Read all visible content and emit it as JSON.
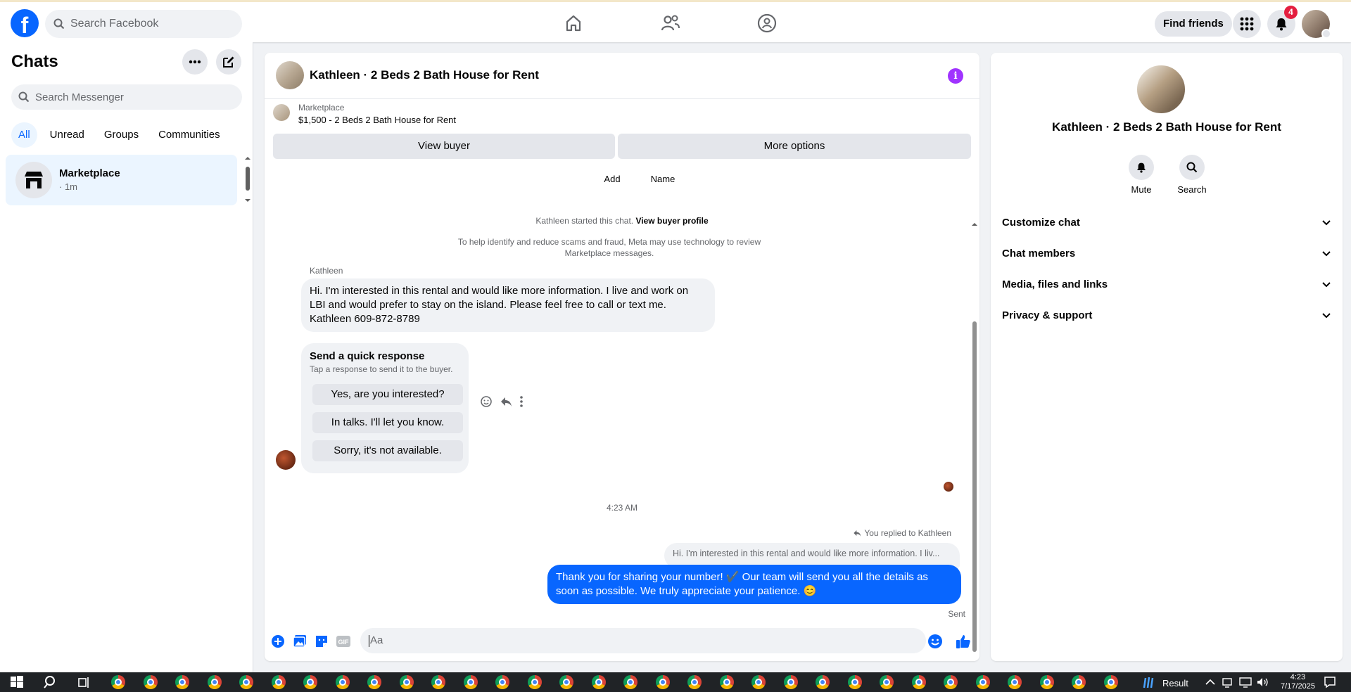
{
  "topbar": {
    "logo_letter": "f",
    "search_placeholder": "Search Facebook",
    "find_friends": "Find friends",
    "notification_count": "4"
  },
  "sidebar": {
    "title": "Chats",
    "search_placeholder": "Search Messenger",
    "filters": [
      "All",
      "Unread",
      "Groups",
      "Communities"
    ],
    "chats": [
      {
        "name": "Marketplace",
        "time": "· 1m"
      }
    ]
  },
  "conversation": {
    "title": "Kathleen · 2 Beds 2 Bath House for Rent",
    "marketplace_label": "Marketplace",
    "listing": "$1,500 - 2 Beds 2 Bath House for Rent",
    "view_buyer": "View buyer",
    "more_options": "More options",
    "add_label": "Add",
    "name_label": "Name",
    "started_prefix": "Kathleen started this chat.",
    "view_buyer_profile": "View buyer profile",
    "notice": "To help identify and reduce scams and fraud, Meta may use technology to review Marketplace messages.",
    "sender": "Kathleen",
    "incoming_message": "Hi. I'm interested in this rental and would like more information. I live and work on LBI and would prefer to stay on the island. Please feel free to call or text me. Kathleen  609-872-8789",
    "quick_response_title": "Send a quick response",
    "quick_response_sub": "Tap a response to send it to the buyer.",
    "quick_responses": [
      "Yes, are you interested?",
      "In talks. I'll let you know.",
      "Sorry, it's not available."
    ],
    "timestamp": "4:23 AM",
    "replied_to": "You replied to Kathleen",
    "reply_quote": "Hi. I'm interested in this rental and would like more information. I liv...",
    "outgoing_message": "Thank you for sharing your number! ✔️ Our team will send you all the details as soon as possible. We truly appreciate your patience. 😊",
    "status": "Sent",
    "composer_placeholder": "Aa",
    "gif_label": "GIF"
  },
  "details": {
    "title": "Kathleen · 2 Beds 2 Bath House for Rent",
    "actions": [
      "Mute",
      "Search"
    ],
    "sections": [
      "Customize chat",
      "Chat members",
      "Media, files and links",
      "Privacy & support"
    ]
  },
  "taskbar": {
    "weather_label": "Result",
    "time": "4:23",
    "date": "7/17/2025"
  },
  "colors": {
    "brand": "#0866ff",
    "badge": "#e41e3f",
    "info": "#a033ff",
    "bubble_out": "#0866ff",
    "bubble_in": "#f0f2f5"
  },
  "icons": [
    "facebook-logo",
    "search-icon",
    "home-icon",
    "friends-icon",
    "groups-icon",
    "menu-grid-icon",
    "bell-icon",
    "more-icon",
    "compose-icon",
    "store-icon",
    "info-icon",
    "emoji-icon",
    "reply-icon",
    "more-vertical-icon",
    "plus-icon",
    "photo-icon",
    "sticker-icon",
    "gif-icon",
    "like-icon",
    "chevron-down-icon"
  ]
}
